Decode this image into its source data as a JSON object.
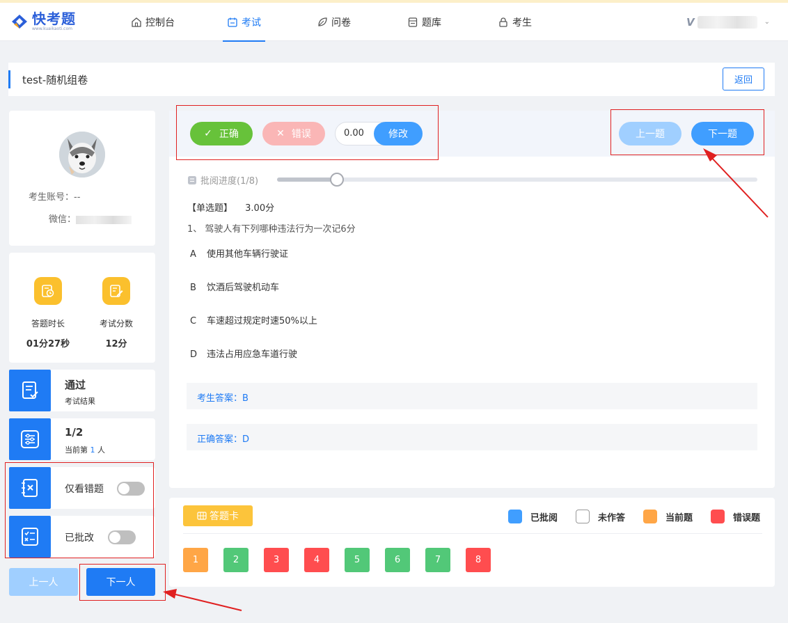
{
  "nav": {
    "logo_title": "快考题",
    "logo_sub": "www.kuaikaoti.com",
    "items": [
      {
        "label": "控制台",
        "icon": "home-icon"
      },
      {
        "label": "考试",
        "icon": "calendar-icon"
      },
      {
        "label": "问卷",
        "icon": "leaf-icon"
      },
      {
        "label": "题库",
        "icon": "database-icon"
      },
      {
        "label": "考生",
        "icon": "lock-icon"
      }
    ],
    "active": "考试",
    "user_initial": "V"
  },
  "page": {
    "title": "test-随机组卷",
    "back_label": "返回"
  },
  "profile": {
    "account_label": "考生账号：--",
    "wechat_label": "微信："
  },
  "stats": [
    {
      "label": "答题时长",
      "value": "01分27秒"
    },
    {
      "label": "考试分数",
      "value": "12分"
    }
  ],
  "tiles": {
    "result_main": "通过",
    "result_sub": "考试结果",
    "position_main": "1/2",
    "position_sub_prefix": "当前第",
    "position_sub_num": "1",
    "position_sub_suffix": "人",
    "wrong_only_label": "仅看错题",
    "reviewed_label": "已批改"
  },
  "bottom_buttons": {
    "prev_person": "上一人",
    "next_person": "下一人"
  },
  "review": {
    "correct_label": "正确",
    "wrong_label": "错误",
    "score_value": "0.00",
    "modify_label": "修改",
    "prev_question": "上一题",
    "next_question": "下一题",
    "progress_label": "批阅进度(1/8)",
    "progress_fraction": 0.125
  },
  "question": {
    "type": "【单选题】",
    "score": "3.00分",
    "text": "1、 驾驶人有下列哪种违法行为一次记6分",
    "options": [
      {
        "letter": "A",
        "text": "使用其他车辆行驶证"
      },
      {
        "letter": "B",
        "text": "饮酒后驾驶机动车"
      },
      {
        "letter": "C",
        "text": "车速超过规定时速50%以上"
      },
      {
        "letter": "D",
        "text": "违法占用应急车道行驶"
      }
    ],
    "student_answer": "考生答案：B",
    "correct_answer": "正确答案：D"
  },
  "answer_card": {
    "title": "答题卡",
    "legend": [
      {
        "label": "已批阅",
        "color": "#409eff"
      },
      {
        "label": "未作答",
        "color": "#ffffff"
      },
      {
        "label": "当前题",
        "color": "#ffa646"
      },
      {
        "label": "错误题",
        "color": "#ff4d4f"
      }
    ],
    "numbers": [
      {
        "n": "1",
        "color": "#ffa646"
      },
      {
        "n": "2",
        "color": "#52c878"
      },
      {
        "n": "3",
        "color": "#ff4d4f"
      },
      {
        "n": "4",
        "color": "#ff4d4f"
      },
      {
        "n": "5",
        "color": "#52c878"
      },
      {
        "n": "6",
        "color": "#52c878"
      },
      {
        "n": "7",
        "color": "#52c878"
      },
      {
        "n": "8",
        "color": "#ff4d4f"
      }
    ]
  },
  "colors": {
    "primary": "#1f7bf4",
    "correct_green": "#67c23a",
    "wrong_pink": "#fab6b6",
    "highlight_red": "#e02020"
  }
}
